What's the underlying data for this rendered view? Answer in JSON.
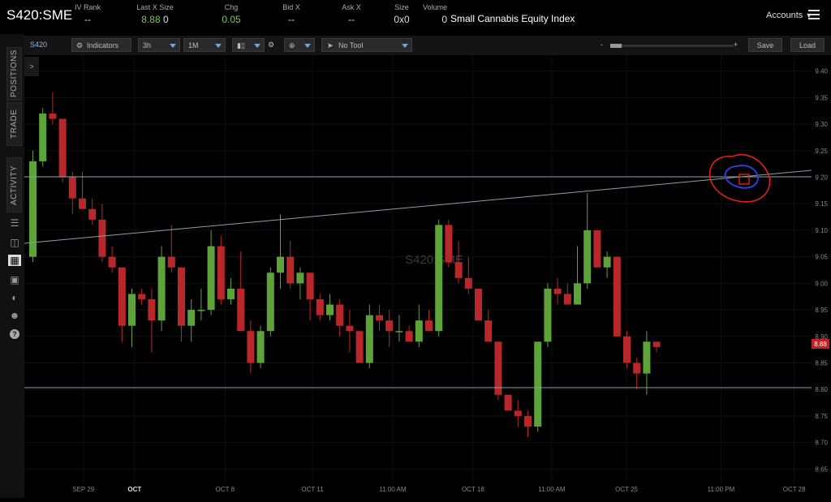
{
  "header": {
    "symbol": "S420:SME",
    "quote_cells": [
      {
        "label": "IV Rank",
        "value": "--"
      },
      {
        "label": "Last X Size",
        "value": "8.88",
        "value2": "0"
      },
      {
        "label": "Chg",
        "value": "0.05"
      },
      {
        "label": "Bid X",
        "value": "--"
      },
      {
        "label": "Ask X",
        "value": "--"
      },
      {
        "label": "Size",
        "value": "0x0"
      },
      {
        "label": "Volume",
        "value": "0"
      }
    ],
    "description": "Small Cannabis Equity Index",
    "accounts_label": "Accounts"
  },
  "sidebar": {
    "tabs": [
      "POSITIONS",
      "TRADE",
      "ACTIVITY"
    ],
    "icons": [
      "list-icon",
      "monitor-icon",
      "chart-icon",
      "grid-icon",
      "gauge-icon",
      "people-icon",
      "help-icon"
    ]
  },
  "toolbar": {
    "symbol": "S420 SME",
    "indicators": "Indicators",
    "interval": "3h",
    "range": "1M",
    "tool": "No Tool",
    "zoom_minus": "-",
    "zoom_plus": "+",
    "save": "Save",
    "load": "Load",
    "collapse": ">"
  },
  "chart_data": {
    "type": "candlestick",
    "watermark": "S420:SME",
    "ylim": [
      8.62,
      9.43
    ],
    "y_ticks": [
      "9.40",
      "9.35",
      "9.30",
      "9.25",
      "9.20",
      "9.15",
      "9.10",
      "9.05",
      "9.00",
      "8.95",
      "8.90",
      "8.85",
      "8.80",
      "8.75",
      "8.70",
      "8.65"
    ],
    "x_ticks": [
      "SEP 29",
      "OCT",
      "OCT 8",
      "OCT 11",
      "11:00 AM",
      "OCT 18",
      "11:00 AM",
      "OCT 25",
      "11:00 PM",
      "OCT 28"
    ],
    "last_price": "8.88",
    "up_color": "#5ea33a",
    "down_color": "#b8282a",
    "candles": [
      {
        "o": 9.05,
        "h": 9.25,
        "l": 9.04,
        "c": 9.23
      },
      {
        "o": 9.23,
        "h": 9.33,
        "l": 9.22,
        "c": 9.32
      },
      {
        "o": 9.32,
        "h": 9.36,
        "l": 9.3,
        "c": 9.31
      },
      {
        "o": 9.31,
        "h": 9.31,
        "l": 9.19,
        "c": 9.2
      },
      {
        "o": 9.2,
        "h": 9.21,
        "l": 9.13,
        "c": 9.16
      },
      {
        "o": 9.16,
        "h": 9.21,
        "l": 9.14,
        "c": 9.14
      },
      {
        "o": 9.14,
        "h": 9.16,
        "l": 9.11,
        "c": 9.12
      },
      {
        "o": 9.12,
        "h": 9.15,
        "l": 9.04,
        "c": 9.05
      },
      {
        "o": 9.05,
        "h": 9.07,
        "l": 9.02,
        "c": 9.03
      },
      {
        "o": 9.03,
        "h": 9.03,
        "l": 8.89,
        "c": 8.92
      },
      {
        "o": 8.92,
        "h": 8.99,
        "l": 8.88,
        "c": 8.98
      },
      {
        "o": 8.98,
        "h": 8.99,
        "l": 8.96,
        "c": 8.97
      },
      {
        "o": 8.97,
        "h": 8.99,
        "l": 8.87,
        "c": 8.93
      },
      {
        "o": 8.93,
        "h": 9.07,
        "l": 8.91,
        "c": 9.05
      },
      {
        "o": 9.05,
        "h": 9.11,
        "l": 9.02,
        "c": 9.03
      },
      {
        "o": 9.03,
        "h": 9.03,
        "l": 8.89,
        "c": 8.92
      },
      {
        "o": 8.92,
        "h": 8.97,
        "l": 8.89,
        "c": 8.95
      },
      {
        "o": 8.95,
        "h": 8.99,
        "l": 8.93,
        "c": 8.95
      },
      {
        "o": 8.95,
        "h": 9.1,
        "l": 8.94,
        "c": 9.07
      },
      {
        "o": 9.07,
        "h": 9.09,
        "l": 8.96,
        "c": 8.97
      },
      {
        "o": 8.97,
        "h": 9.01,
        "l": 8.96,
        "c": 8.99
      },
      {
        "o": 8.99,
        "h": 9.06,
        "l": 8.91,
        "c": 8.91
      },
      {
        "o": 8.91,
        "h": 8.93,
        "l": 8.83,
        "c": 8.85
      },
      {
        "o": 8.85,
        "h": 8.92,
        "l": 8.84,
        "c": 8.91
      },
      {
        "o": 8.91,
        "h": 9.03,
        "l": 8.9,
        "c": 9.02
      },
      {
        "o": 9.02,
        "h": 9.13,
        "l": 8.99,
        "c": 9.05
      },
      {
        "o": 9.05,
        "h": 9.08,
        "l": 8.99,
        "c": 9.0
      },
      {
        "o": 9.0,
        "h": 9.03,
        "l": 8.97,
        "c": 9.02
      },
      {
        "o": 9.02,
        "h": 9.02,
        "l": 8.93,
        "c": 8.97
      },
      {
        "o": 8.97,
        "h": 8.98,
        "l": 8.93,
        "c": 8.94
      },
      {
        "o": 8.94,
        "h": 8.98,
        "l": 8.93,
        "c": 8.96
      },
      {
        "o": 8.96,
        "h": 8.97,
        "l": 8.9,
        "c": 8.92
      },
      {
        "o": 8.92,
        "h": 8.95,
        "l": 8.87,
        "c": 8.91
      },
      {
        "o": 8.91,
        "h": 8.91,
        "l": 8.85,
        "c": 8.85
      },
      {
        "o": 8.85,
        "h": 8.96,
        "l": 8.84,
        "c": 8.94
      },
      {
        "o": 8.94,
        "h": 8.96,
        "l": 8.91,
        "c": 8.93
      },
      {
        "o": 8.93,
        "h": 8.95,
        "l": 8.88,
        "c": 8.91
      },
      {
        "o": 8.91,
        "h": 8.94,
        "l": 8.89,
        "c": 8.91
      },
      {
        "o": 8.91,
        "h": 8.92,
        "l": 8.89,
        "c": 8.89
      },
      {
        "o": 8.89,
        "h": 8.96,
        "l": 8.88,
        "c": 8.93
      },
      {
        "o": 8.93,
        "h": 8.95,
        "l": 8.91,
        "c": 8.91
      },
      {
        "o": 8.91,
        "h": 9.12,
        "l": 8.9,
        "c": 9.11
      },
      {
        "o": 9.11,
        "h": 9.12,
        "l": 9.03,
        "c": 9.04
      },
      {
        "o": 9.04,
        "h": 9.08,
        "l": 9.0,
        "c": 9.01
      },
      {
        "o": 9.01,
        "h": 9.05,
        "l": 8.98,
        "c": 8.99
      },
      {
        "o": 8.99,
        "h": 8.99,
        "l": 8.93,
        "c": 8.93
      },
      {
        "o": 8.93,
        "h": 8.95,
        "l": 8.89,
        "c": 8.89
      },
      {
        "o": 8.89,
        "h": 8.89,
        "l": 8.78,
        "c": 8.79
      },
      {
        "o": 8.79,
        "h": 8.79,
        "l": 8.76,
        "c": 8.76
      },
      {
        "o": 8.76,
        "h": 8.78,
        "l": 8.73,
        "c": 8.75
      },
      {
        "o": 8.75,
        "h": 8.76,
        "l": 8.71,
        "c": 8.73
      },
      {
        "o": 8.73,
        "h": 8.89,
        "l": 8.72,
        "c": 8.89
      },
      {
        "o": 8.89,
        "h": 9.0,
        "l": 8.88,
        "c": 8.99
      },
      {
        "o": 8.99,
        "h": 9.01,
        "l": 8.96,
        "c": 8.98
      },
      {
        "o": 8.98,
        "h": 9.0,
        "l": 8.96,
        "c": 8.96
      },
      {
        "o": 8.96,
        "h": 9.07,
        "l": 8.96,
        "c": 9.0
      },
      {
        "o": 9.0,
        "h": 9.17,
        "l": 8.99,
        "c": 9.1
      },
      {
        "o": 9.1,
        "h": 9.1,
        "l": 9.03,
        "c": 9.03
      },
      {
        "o": 9.03,
        "h": 9.06,
        "l": 9.01,
        "c": 9.05
      },
      {
        "o": 9.05,
        "h": 9.05,
        "l": 8.9,
        "c": 8.9
      },
      {
        "o": 8.9,
        "h": 8.91,
        "l": 8.84,
        "c": 8.85
      },
      {
        "o": 8.85,
        "h": 8.86,
        "l": 8.8,
        "c": 8.83
      },
      {
        "o": 8.83,
        "h": 8.91,
        "l": 8.79,
        "c": 8.89
      },
      {
        "o": 8.89,
        "h": 8.89,
        "l": 8.87,
        "c": 8.88
      }
    ]
  }
}
